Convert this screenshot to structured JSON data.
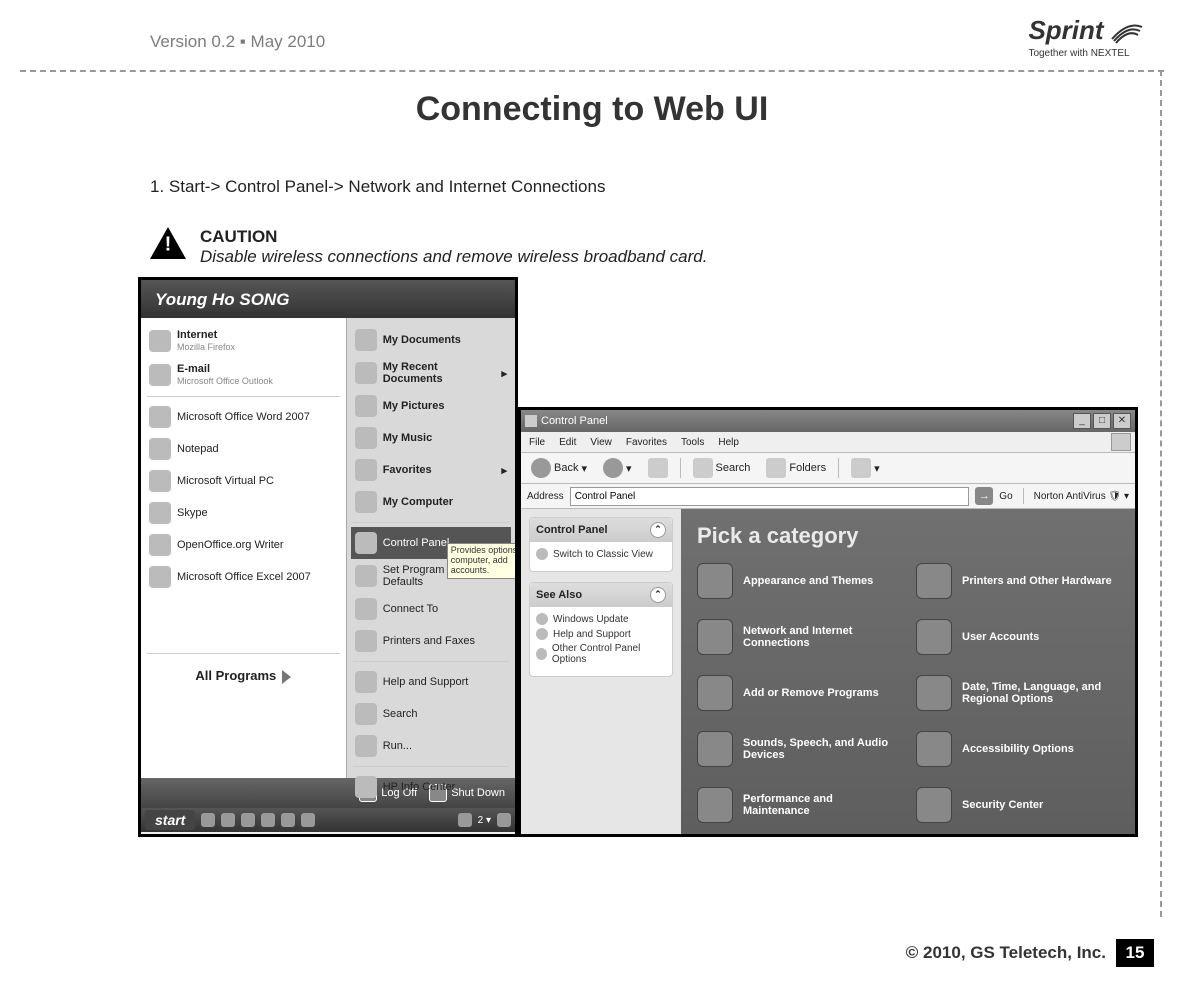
{
  "header": {
    "version": "Version 0.2 ▪ May 2010",
    "brand_name": "Sprint",
    "brand_tagline": "Together with NEXTEL"
  },
  "title": "Connecting to Web UI",
  "step1": "1. Start-> Control Panel-> Network and Internet Connections",
  "caution": {
    "label": "CAUTION",
    "text": "Disable wireless connections and remove wireless broadband card."
  },
  "start_menu": {
    "user": "Young Ho SONG",
    "left_items": [
      {
        "label": "Internet",
        "sub": "Mozilla Firefox"
      },
      {
        "label": "E-mail",
        "sub": "Microsoft Office Outlook"
      },
      {
        "label": "Microsoft Office Word 2007"
      },
      {
        "label": "Notepad"
      },
      {
        "label": "Microsoft Virtual PC"
      },
      {
        "label": "Skype"
      },
      {
        "label": "OpenOffice.org Writer"
      },
      {
        "label": "Microsoft Office Excel 2007"
      }
    ],
    "all_programs": "All Programs",
    "right_items": [
      {
        "label": "My Documents",
        "bold": true
      },
      {
        "label": "My Recent Documents",
        "bold": true,
        "arrow": true
      },
      {
        "label": "My Pictures",
        "bold": true
      },
      {
        "label": "My Music",
        "bold": true
      },
      {
        "label": "Favorites",
        "bold": true,
        "arrow": true
      },
      {
        "label": "My Computer",
        "bold": true
      },
      {
        "label": "Control Panel",
        "highlight": true
      },
      {
        "label": "Set Program Access and Defaults"
      },
      {
        "label": "Connect To"
      },
      {
        "label": "Printers and Faxes"
      },
      {
        "label": "Help and Support"
      },
      {
        "label": "Search"
      },
      {
        "label": "Run..."
      },
      {
        "label": "HP Info Center"
      }
    ],
    "tooltip": "Provides options computer, add accounts.",
    "logoff": "Log Off",
    "shutdown": "Shut Down",
    "taskbar_start": "start"
  },
  "control_panel": {
    "title": "Control Panel",
    "menus": [
      "File",
      "Edit",
      "View",
      "Favorites",
      "Tools",
      "Help"
    ],
    "toolbar": {
      "back": "Back",
      "search": "Search",
      "folders": "Folders"
    },
    "address_label": "Address",
    "address_value": "Control Panel",
    "go": "Go",
    "norton": "Norton AntiVirus",
    "side": {
      "panel1_title": "Control Panel",
      "panel1_link": "Switch to Classic View",
      "panel2_title": "See Also",
      "panel2_links": [
        "Windows Update",
        "Help and Support",
        "Other Control Panel Options"
      ]
    },
    "main_heading": "Pick a category",
    "categories": [
      "Appearance and Themes",
      "Printers and Other Hardware",
      "Network and Internet Connections",
      "User Accounts",
      "Add or Remove Programs",
      "Date, Time, Language, and Regional Options",
      "Sounds, Speech, and Audio Devices",
      "Accessibility Options",
      "Performance and Maintenance",
      "Security Center"
    ]
  },
  "footer": {
    "copyright": "© 2010, GS Teletech, Inc.",
    "page": "15"
  }
}
